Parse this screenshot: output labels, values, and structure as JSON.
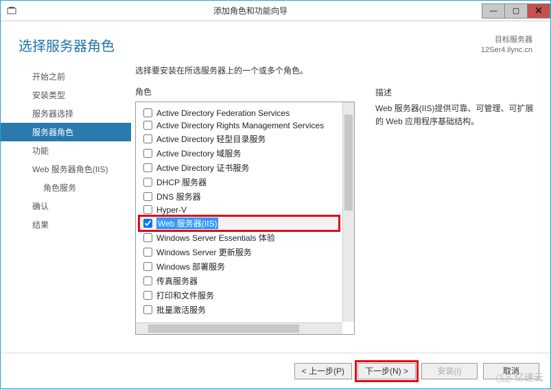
{
  "window": {
    "title": "添加角色和功能向导"
  },
  "header": {
    "page_title": "选择服务器角色",
    "dest_label": "目标服务器",
    "dest_value": "12Ser4.ilync.cn"
  },
  "sidebar": {
    "items": [
      {
        "label": "开始之前",
        "selected": false
      },
      {
        "label": "安装类型",
        "selected": false
      },
      {
        "label": "服务器选择",
        "selected": false
      },
      {
        "label": "服务器角色",
        "selected": true
      },
      {
        "label": "功能",
        "selected": false
      },
      {
        "label": "Web 服务器角色(IIS)",
        "selected": false
      },
      {
        "label": "角色服务",
        "selected": false,
        "indent": true
      },
      {
        "label": "确认",
        "selected": false
      },
      {
        "label": "结果",
        "selected": false
      }
    ]
  },
  "main": {
    "instruction": "选择要安装在所选服务器上的一个或多个角色。",
    "roles_label": "角色",
    "desc_label": "描述",
    "roles": [
      {
        "label": "Active Directory Federation Services",
        "checked": false
      },
      {
        "label": "Active Directory Rights Management Services",
        "checked": false
      },
      {
        "label": "Active Directory 轻型目录服务",
        "checked": false
      },
      {
        "label": "Active Directory 域服务",
        "checked": false
      },
      {
        "label": "Active Directory 证书服务",
        "checked": false
      },
      {
        "label": "DHCP 服务器",
        "checked": false
      },
      {
        "label": "DNS 服务器",
        "checked": false
      },
      {
        "label": "Hyper-V",
        "checked": false
      },
      {
        "label": "Web 服务器(IIS)",
        "checked": true,
        "highlighted": true
      },
      {
        "label": "Windows Server Essentials 体验",
        "checked": false
      },
      {
        "label": "Windows Server 更新服务",
        "checked": false
      },
      {
        "label": "Windows 部署服务",
        "checked": false
      },
      {
        "label": "传真服务器",
        "checked": false
      },
      {
        "label": "打印和文件服务",
        "checked": false
      },
      {
        "label": "批量激活服务",
        "checked": false
      }
    ],
    "description": "Web 服务器(IIS)提供可靠、可管理、可扩展的 Web 应用程序基础结构。"
  },
  "footer": {
    "prev": "< 上一步(P)",
    "next": "下一步(N) >",
    "install": "安装(I)",
    "cancel": "取消"
  },
  "watermark": "亿速云"
}
